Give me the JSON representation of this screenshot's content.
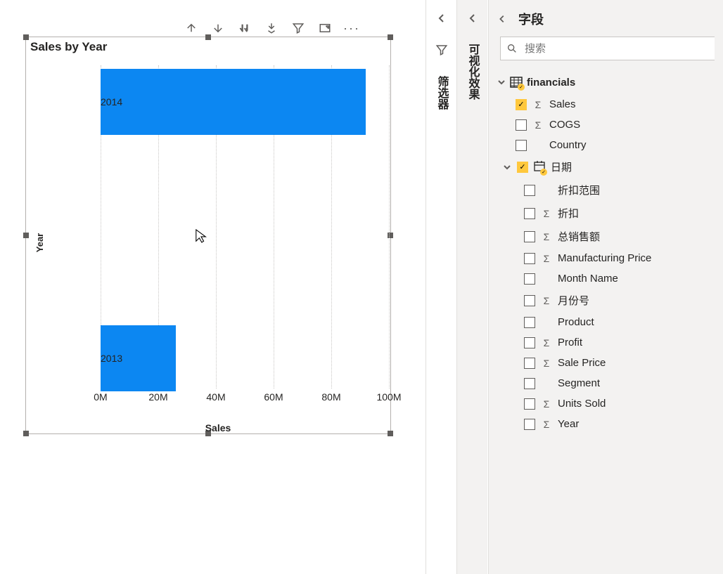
{
  "chart_data": {
    "type": "bar",
    "orientation": "horizontal",
    "title": "Sales by Year",
    "xlabel": "Sales",
    "ylabel": "Year",
    "categories": [
      "2014",
      "2013"
    ],
    "values": [
      92000000,
      26000000
    ],
    "ticks": [
      "0M",
      "20M",
      "40M",
      "60M",
      "80M",
      "100M"
    ],
    "xlim": [
      0,
      100000000
    ]
  },
  "panes": {
    "filters_collapsed_label": "筛选器",
    "viz_collapsed_label": "可视化效果"
  },
  "fields_pane": {
    "title": "字段",
    "search_placeholder": "搜索",
    "table": {
      "name": "financials",
      "expanded": true,
      "fields": [
        {
          "name": "Sales",
          "checked": true,
          "sigma": true
        },
        {
          "name": "COGS",
          "checked": false,
          "sigma": true
        },
        {
          "name": "Country",
          "checked": false,
          "sigma": false
        },
        {
          "name": "日期",
          "checked": true,
          "sigma": false,
          "hierarchy": true
        },
        {
          "name": "折扣范围",
          "checked": false,
          "sigma": false,
          "sub": true
        },
        {
          "name": "折扣",
          "checked": false,
          "sigma": true,
          "sub": true
        },
        {
          "name": "总销售额",
          "checked": false,
          "sigma": true,
          "sub": true
        },
        {
          "name": "Manufacturing Price",
          "checked": false,
          "sigma": true,
          "sub": true
        },
        {
          "name": "Month Name",
          "checked": false,
          "sigma": false,
          "sub": true
        },
        {
          "name": "月份号",
          "checked": false,
          "sigma": true,
          "sub": true
        },
        {
          "name": "Product",
          "checked": false,
          "sigma": false,
          "sub": true
        },
        {
          "name": "Profit",
          "checked": false,
          "sigma": true,
          "sub": true
        },
        {
          "name": "Sale Price",
          "checked": false,
          "sigma": true,
          "sub": true
        },
        {
          "name": "Segment",
          "checked": false,
          "sigma": false,
          "sub": true
        },
        {
          "name": "Units Sold",
          "checked": false,
          "sigma": true,
          "sub": true
        },
        {
          "name": "Year",
          "checked": false,
          "sigma": true,
          "sub": true
        }
      ]
    }
  }
}
